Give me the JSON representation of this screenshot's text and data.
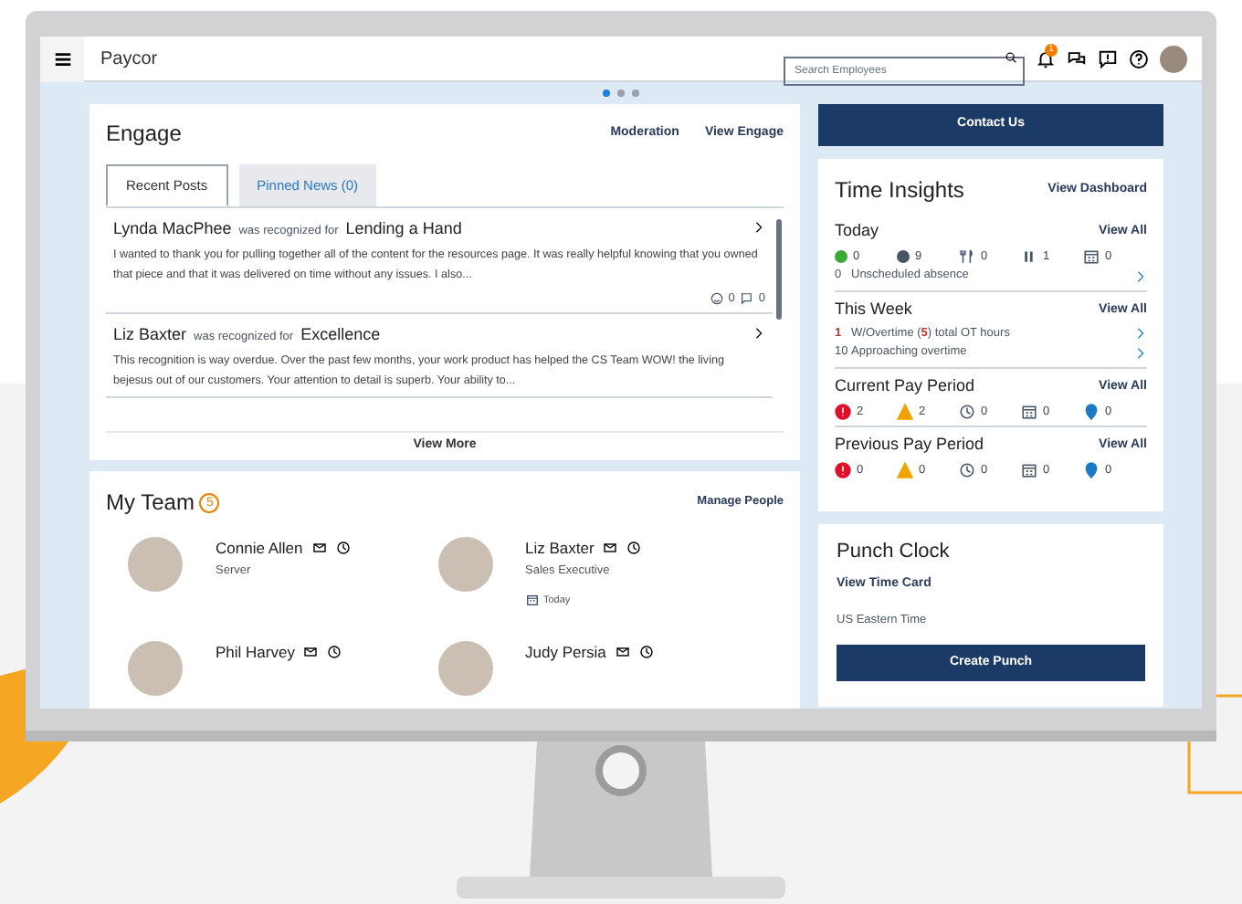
{
  "header": {
    "logo": "Paycor",
    "search": {
      "placeholder": "Search Employees"
    },
    "notification_badge": "1"
  },
  "carousel": [
    {
      "selected": true
    },
    {
      "selected": false
    },
    {
      "selected": false
    }
  ],
  "engage": {
    "title": "Engage",
    "links": [
      "Moderation",
      "View Engage"
    ],
    "tabs": [
      {
        "label": "Recent Posts",
        "selected": true
      },
      {
        "label": "Pinned News (0)",
        "selected": false
      }
    ],
    "posts": [
      {
        "name": "Lynda MacPhee",
        "verb": "was recognized for",
        "award": "Lending a Hand",
        "body": "I wanted to thank you for pulling together all of the content for the resources page. It was really helpful knowing that you owned that piece and that it was delivered on time without any issues. I also...",
        "reactions": "0",
        "comments": "0"
      },
      {
        "name": "Liz Baxter",
        "verb": "was recognized for",
        "award": "Excellence",
        "body": "This recognition is way overdue. Over the past few months, your work product has helped the CS Team WOW! the living bejesus out of our customers. Your attention to detail is superb. Your ability to..."
      }
    ],
    "view_more": "View More"
  },
  "contact_button": "Contact Us",
  "time_insights": {
    "title": "Time Insights",
    "link": "View Dashboard",
    "sections": [
      {
        "title": "Today",
        "link": "View All",
        "stats": [
          {
            "kind": "dot",
            "color": "#3aa935",
            "value": "0"
          },
          {
            "kind": "dot",
            "color": "#4a5563",
            "value": "9"
          },
          {
            "kind": "meal",
            "value": "0"
          },
          {
            "kind": "pause",
            "value": "1"
          },
          {
            "kind": "calendar",
            "value": "0"
          }
        ],
        "lines": [
          {
            "count": "0",
            "text": "Unscheduled absence",
            "highlighted": false
          }
        ]
      },
      {
        "title": "This Week",
        "link": "View All",
        "lines": [
          {
            "count": "1",
            "text": "W/Overtime (**5**) total OT hours",
            "highlighted": true
          },
          {
            "count": "10",
            "text": "Approaching overtime",
            "highlighted": false
          }
        ]
      },
      {
        "title": "Current Pay Period",
        "link": "View All",
        "stats": [
          {
            "kind": "error",
            "value": "2"
          },
          {
            "kind": "warning",
            "value": "2"
          },
          {
            "kind": "clock",
            "value": "0"
          },
          {
            "kind": "calendar",
            "value": "0"
          },
          {
            "kind": "pin",
            "value": "0"
          }
        ]
      },
      {
        "title": "Previous Pay Period",
        "link": "View All",
        "stats": [
          {
            "kind": "error",
            "value": "0"
          },
          {
            "kind": "warning",
            "value": "0"
          },
          {
            "kind": "clock",
            "value": "0"
          },
          {
            "kind": "calendar",
            "value": "0"
          },
          {
            "kind": "pin",
            "value": "0"
          }
        ]
      }
    ]
  },
  "my_team": {
    "title": "My Team",
    "count": "5",
    "link": "Manage People",
    "members": [
      {
        "name": "Connie Allen",
        "role": "Server"
      },
      {
        "name": "Liz Baxter",
        "role": "Sales Executive",
        "note": "Today"
      },
      {
        "name": "Phil Harvey"
      },
      {
        "name": "Judy Persia"
      }
    ]
  },
  "punch_clock": {
    "title": "Punch Clock",
    "link": "View Time Card",
    "timezone": "US Eastern Time",
    "button": "Create Punch"
  }
}
